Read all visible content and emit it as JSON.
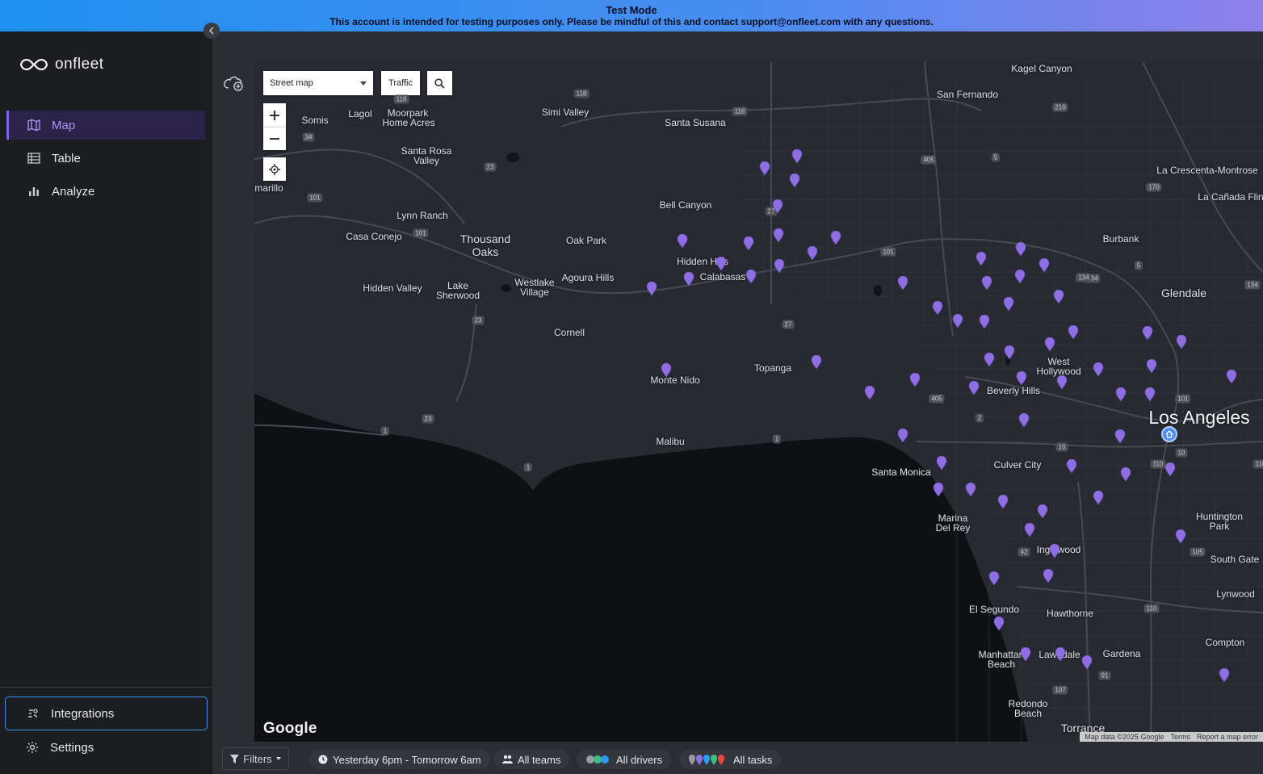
{
  "banner": {
    "title": "Test Mode",
    "message": "This account is intended for testing purposes only. Please be mindful of this and contact support@onfleet.com with any questions."
  },
  "brand": {
    "name": "onfleet"
  },
  "nav": {
    "items": [
      {
        "label": "Map",
        "icon": "map-icon",
        "active": true
      },
      {
        "label": "Table",
        "icon": "table-icon",
        "active": false
      },
      {
        "label": "Analyze",
        "icon": "bar-chart-icon",
        "active": false
      }
    ],
    "bottom": [
      {
        "label": "Integrations",
        "icon": "integrations-icon"
      },
      {
        "label": "Settings",
        "icon": "gear-icon"
      }
    ]
  },
  "map": {
    "map_type": "Street map",
    "traffic_label": "Traffic",
    "attribution": {
      "google": "Google",
      "data": "Map data ©2025 Google",
      "terms": "Terms",
      "report": "Report a map error"
    },
    "places": [
      {
        "name": "Kagel Canyon"
      },
      {
        "name": "San Fernando"
      },
      {
        "name": "La Crescenta-Montrose"
      },
      {
        "name": "La Cañada Flintridge"
      },
      {
        "name": "Burbank"
      },
      {
        "name": "Glendale"
      },
      {
        "name": "Moorpark"
      },
      {
        "name": "Home Acres"
      },
      {
        "name": "Somis"
      },
      {
        "name": "Lagol"
      },
      {
        "name": "Simi Valley"
      },
      {
        "name": "Santa Susana"
      },
      {
        "name": "Santa Rosa Valley"
      },
      {
        "name": "marillo"
      },
      {
        "name": "Lynn Ranch"
      },
      {
        "name": "Casa Conejo"
      },
      {
        "name": "Thousand Oaks"
      },
      {
        "name": "Oak Park"
      },
      {
        "name": "Bell Canyon"
      },
      {
        "name": "Hidden Hills"
      },
      {
        "name": "Calabasas"
      },
      {
        "name": "Hidden Valley"
      },
      {
        "name": "Lake Sherwood"
      },
      {
        "name": "Westlake Village"
      },
      {
        "name": "Agoura Hills"
      },
      {
        "name": "Cornell"
      },
      {
        "name": "Monte Nido"
      },
      {
        "name": "Topanga"
      },
      {
        "name": "Malibu"
      },
      {
        "name": "West Hollywood"
      },
      {
        "name": "Beverly Hills"
      },
      {
        "name": "Los Angeles"
      },
      {
        "name": "Santa Monica"
      },
      {
        "name": "Culver City"
      },
      {
        "name": "Marina Del Rey"
      },
      {
        "name": "Huntington Park"
      },
      {
        "name": "South Gate"
      },
      {
        "name": "Inglewood"
      },
      {
        "name": "El Segundo"
      },
      {
        "name": "Hawthorne"
      },
      {
        "name": "Lynwood"
      },
      {
        "name": "Compton"
      },
      {
        "name": "Manhattan Beach"
      },
      {
        "name": "Lawndale"
      },
      {
        "name": "Gardena"
      },
      {
        "name": "Redondo Beach"
      },
      {
        "name": "Torrance"
      }
    ],
    "highways": [
      "118",
      "118",
      "118",
      "210",
      "405",
      "5",
      "170",
      "134",
      "5",
      "101",
      "101",
      "23",
      "34",
      "101",
      "23",
      "27",
      "23",
      "1",
      "1",
      "1",
      "405",
      "10",
      "2",
      "10",
      "110",
      "110",
      "42",
      "105",
      "91",
      "107",
      "134",
      "134",
      "101",
      "110",
      "27"
    ],
    "pin_color": "#8e6ee0"
  },
  "bottom_bar": {
    "filters": "Filters",
    "time_range": "Yesterday 6pm - Tomorrow 6am",
    "teams": "All teams",
    "drivers": "All drivers",
    "tasks": "All tasks"
  }
}
